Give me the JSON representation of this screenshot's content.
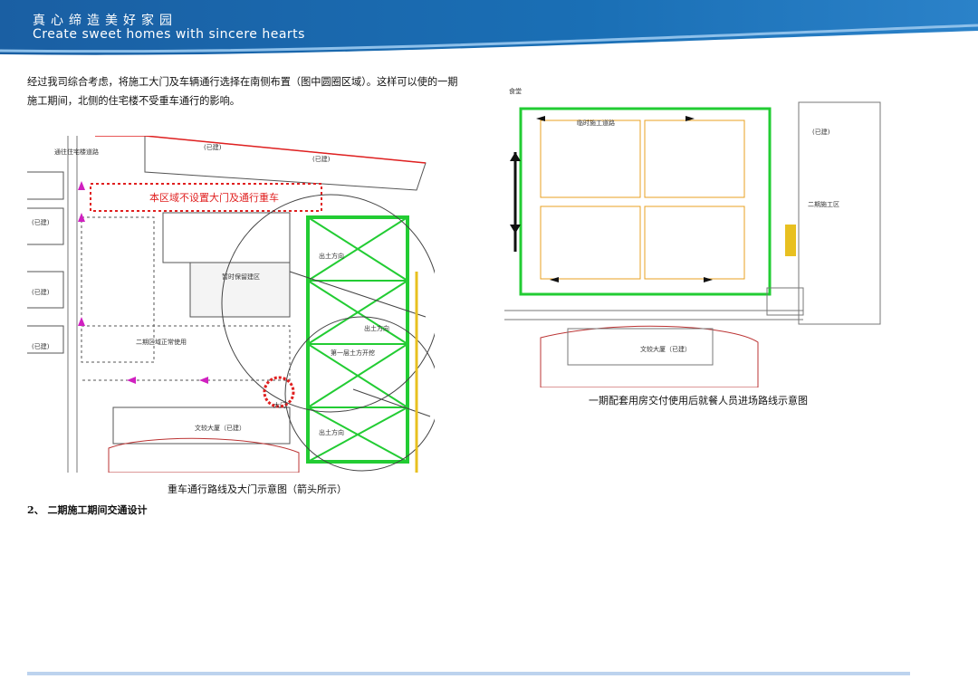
{
  "header": {
    "slogan_cn": "真心缔造美好家园",
    "slogan_en": "Create sweet homes with sincere hearts"
  },
  "body": {
    "paragraph": "经过我司综合考虑，将施工大门及车辆通行选择在南侧布置（图中圆圈区域）。这样可以使的一期施工期间，北侧的住宅楼不受重车通行的影响。",
    "section_heading": "2、 二期施工期间交通设计"
  },
  "figure1": {
    "caption": "重车通行路线及大门示意图（箭头所示）",
    "red_notice": "本区域不设置大门及通行重车",
    "labels": {
      "built_a": "(已建)",
      "built_b": "(已建)",
      "built_c": "(已建)",
      "built_d": "(已建)",
      "built_e": "(已建)",
      "phase2_use": "二期区域正常使用",
      "temp_building": "暂时保留建区",
      "exit1": "出土方向",
      "exit2": "出土方向",
      "exit3": "出土方向",
      "phase1": "第一层土方开挖",
      "wenjiao": "文较大厦（已建）",
      "gate": "大门",
      "road_n": "通往住宅楼道路"
    }
  },
  "figure2": {
    "caption": "一期配套用房交付使用后就餐人员进场路线示意图",
    "labels": {
      "temp_road": "临时施工道路",
      "wenjiao": "文较大厦（已建）",
      "built": "(已建)",
      "phase2": "二期施工区",
      "canteen": "食堂"
    }
  },
  "colors": {
    "banner": "#1a6fb5",
    "green": "#22cc33",
    "red": "#e02020",
    "magenta": "#d020c0",
    "yellow": "#e8c020"
  }
}
